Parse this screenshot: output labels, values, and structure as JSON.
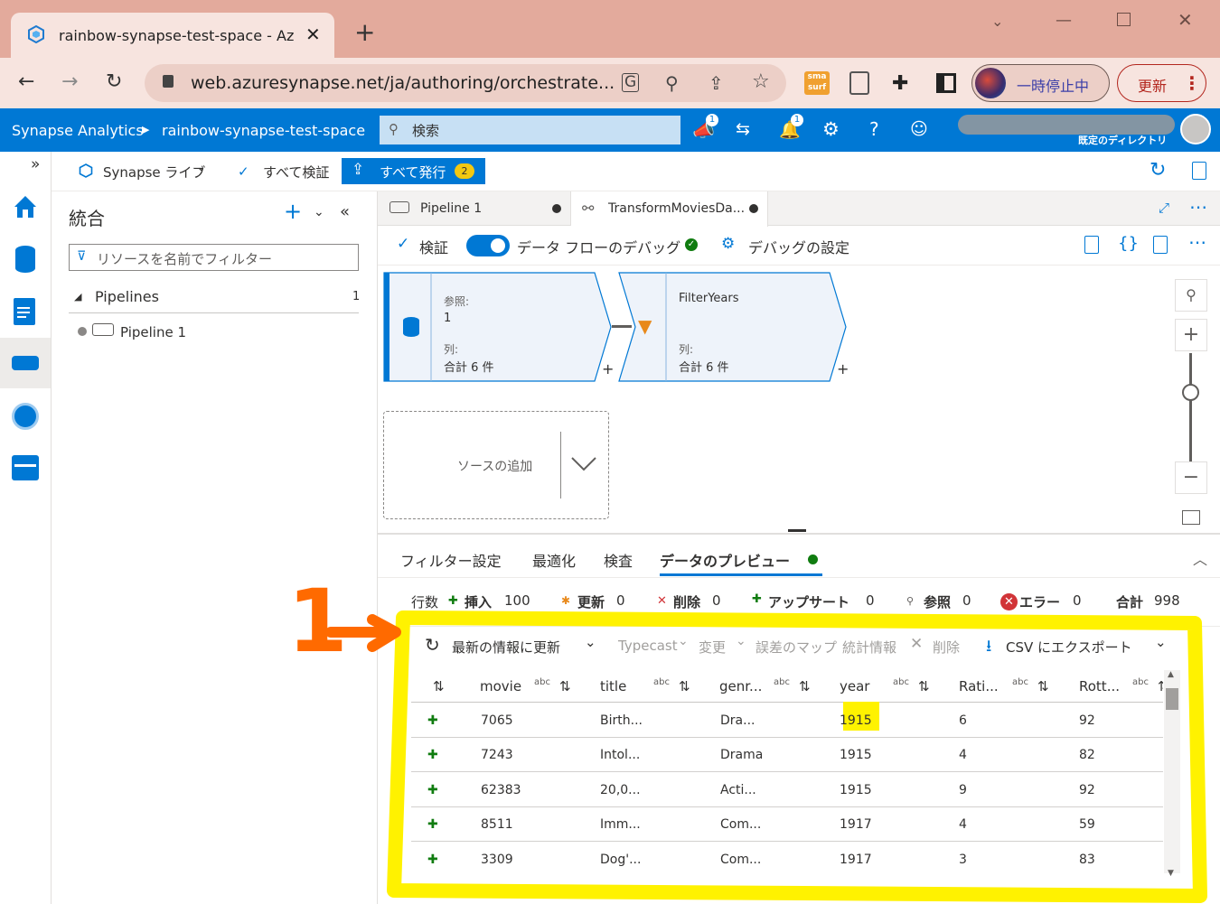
{
  "browser": {
    "tab_title": "rainbow-synapse-test-space - Az",
    "url": "web.azuresynapse.net/ja/authoring/orchestrate...",
    "profile_label": "一時停止中",
    "update_label": "更新",
    "extension_label": "sma surf"
  },
  "header": {
    "brand": "Synapse Analytics",
    "workspace": "rainbow-synapse-test-space",
    "search_placeholder": "検索",
    "directory_label": "既定のディレクトリ",
    "notif_badge_1": "1",
    "notif_badge_2": "1"
  },
  "subbar": {
    "live_label": "Synapse ライブ",
    "validate_all": "すべて検証",
    "publish_all": "すべて発行",
    "publish_count": "2"
  },
  "panel": {
    "title": "統合",
    "filter_placeholder": "リソースを名前でフィルター",
    "group_label": "Pipelines",
    "group_count": "1",
    "item_label": "Pipeline 1"
  },
  "tabs": [
    {
      "label": "Pipeline 1"
    },
    {
      "label": "TransformMoviesDa..."
    }
  ],
  "editor_toolbar": {
    "validate": "検証",
    "debug": "データ フローのデバッグ",
    "debug_settings": "デバッグの設定"
  },
  "canvas": {
    "source_node": {
      "ref_label": "参照:",
      "ref_value": "1",
      "cols_label": "列:",
      "cols_value": "合計 6 件"
    },
    "filter_node": {
      "name": "FilterYears",
      "cols_label": "列:",
      "cols_value": "合計 6 件"
    },
    "add_source": "ソースの追加"
  },
  "bottom_tabs": [
    "フィルター設定",
    "最適化",
    "検査",
    "データのプレビュー"
  ],
  "stats": {
    "rows_label": "行数",
    "insert_label": "挿入",
    "insert_value": "100",
    "update_label": "更新",
    "update_value": "0",
    "delete_label": "削除",
    "delete_value": "0",
    "upsert_label": "アップサート",
    "upsert_value": "0",
    "lookup_label": "参照",
    "lookup_value": "0",
    "error_label": "エラー",
    "error_value": "0",
    "total_label": "合計",
    "total_value": "998"
  },
  "preview_toolbar": {
    "refresh": "最新の情報に更新",
    "typecast": "Typecast",
    "modify": "変更",
    "error_map": "誤差のマップ",
    "stats": "統計情報",
    "remove": "削除",
    "export": "CSV にエクスポート"
  },
  "grid": {
    "columns": [
      "movie",
      "title",
      "genr...",
      "year",
      "Rati...",
      "Rott..."
    ],
    "type_tag": "abc",
    "rows": [
      [
        "7065",
        "Birth...",
        "Dra...",
        "1915",
        "6",
        "92"
      ],
      [
        "7243",
        "Intol...",
        "Drama",
        "1915",
        "4",
        "82"
      ],
      [
        "62383",
        "20,0...",
        "Acti...",
        "1915",
        "9",
        "92"
      ],
      [
        "8511",
        "Imm...",
        "Com...",
        "1917",
        "4",
        "59"
      ],
      [
        "3309",
        "Dog'...",
        "Com...",
        "1917",
        "3",
        "83"
      ]
    ]
  },
  "annotation": {
    "number": "1"
  }
}
